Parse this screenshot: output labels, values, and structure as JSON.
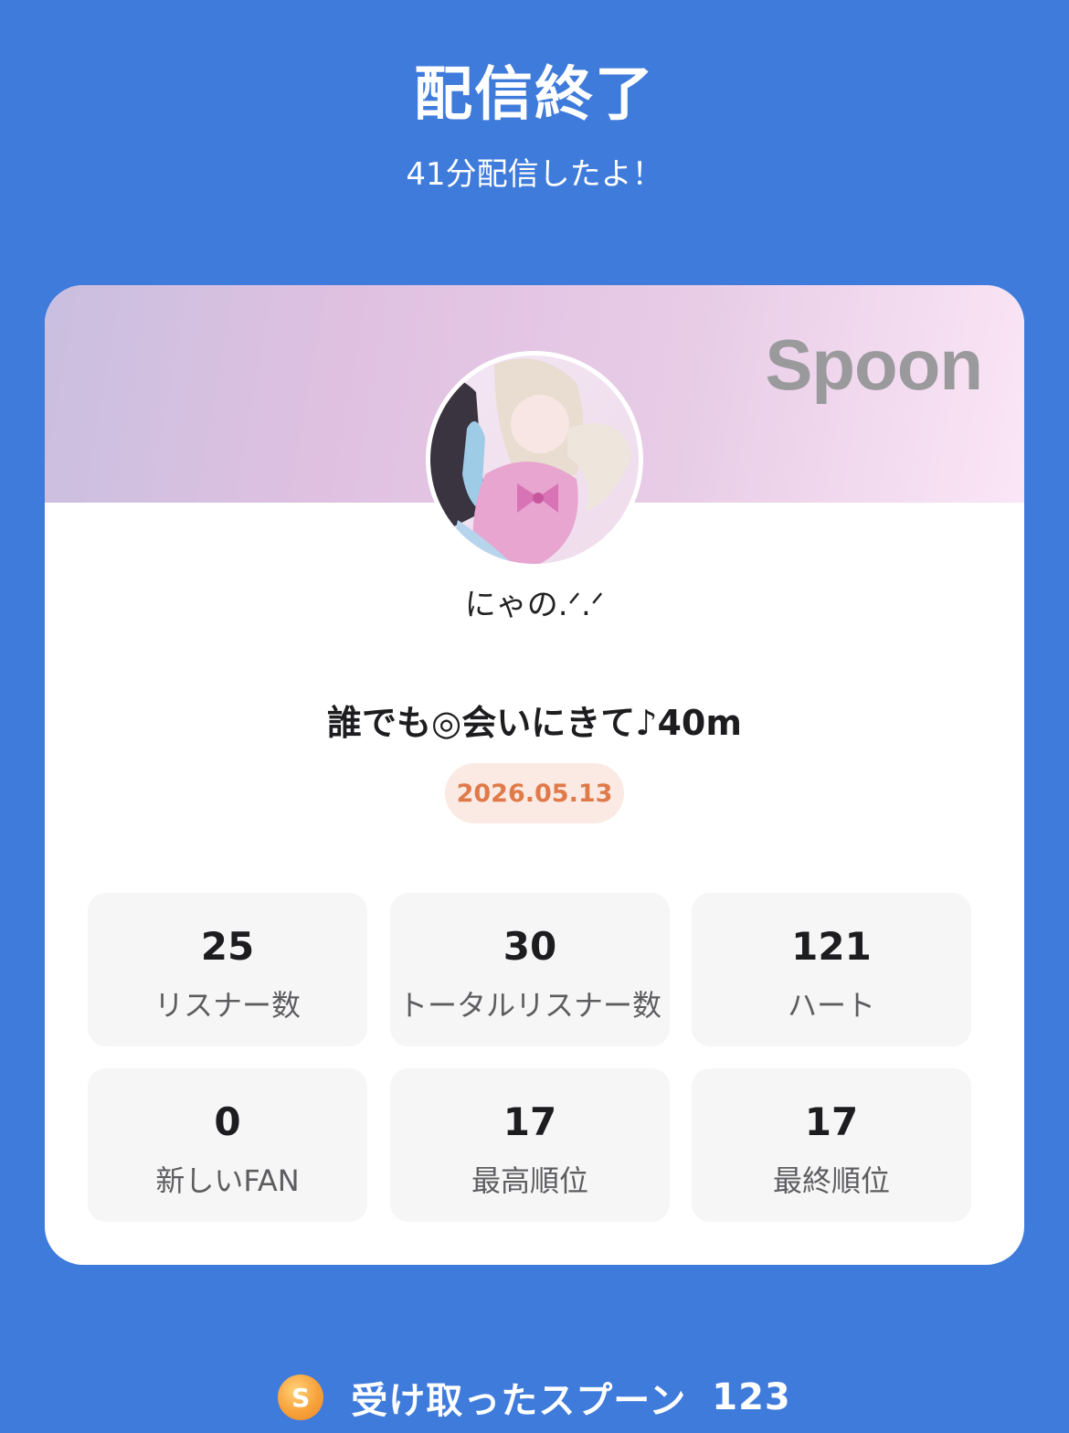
{
  "header": {
    "title": "配信終了",
    "subtitle": "41分配信したよ！"
  },
  "card": {
    "brand": "Spoon",
    "username": "にゃの.ᐟ.ᐟ",
    "stream_title": "誰でも◎会いにきて♪40m",
    "date": "2026.05.13",
    "stats": [
      {
        "value": "25",
        "label": "リスナー数"
      },
      {
        "value": "30",
        "label": "トータルリスナー数"
      },
      {
        "value": "121",
        "label": "ハート"
      },
      {
        "value": "0",
        "label": "新しいFAN"
      },
      {
        "value": "17",
        "label": "最高順位"
      },
      {
        "value": "17",
        "label": "最終順位"
      }
    ]
  },
  "footer": {
    "coin_letter": "S",
    "label": "受け取ったスプーン",
    "count": "123"
  },
  "colors": {
    "background": "#3f7bdb",
    "date_text": "#e07a4a",
    "date_bg": "#fbeae3",
    "coin": "#f8a13a"
  }
}
